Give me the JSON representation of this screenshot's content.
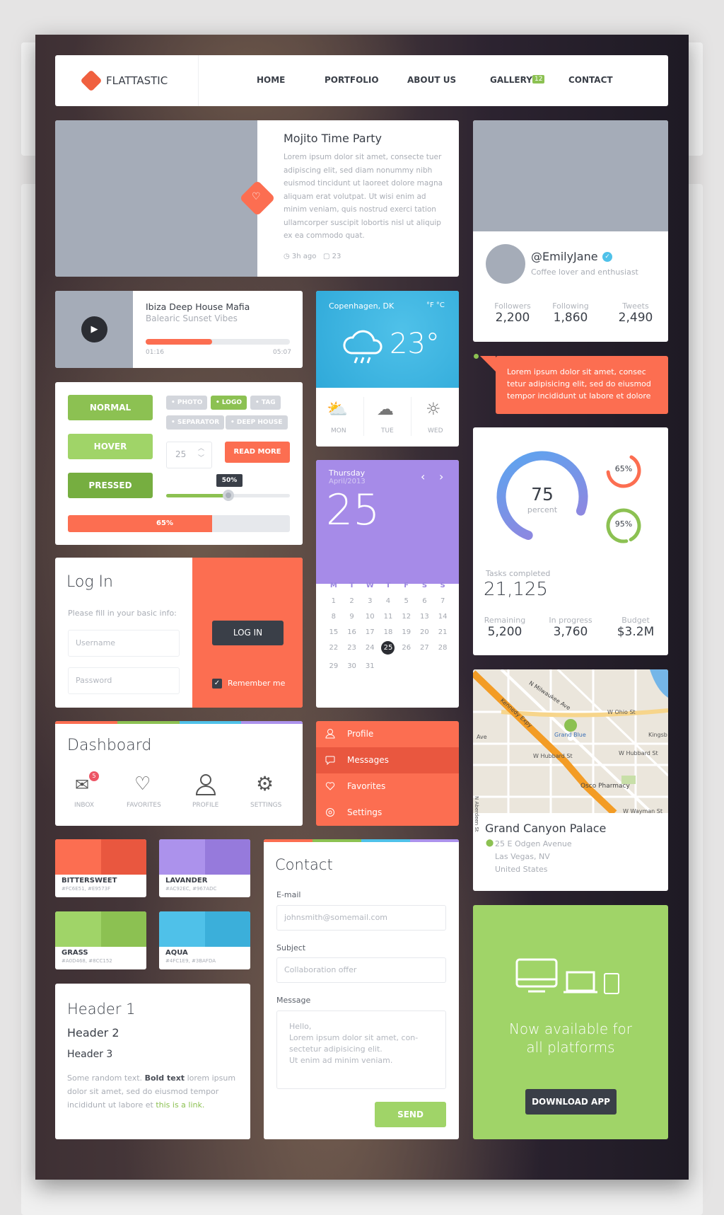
{
  "nav": {
    "logo": "FLATTASTIC",
    "items": [
      "HOME",
      "PORTFOLIO",
      "ABOUT US",
      "GALLERY",
      "CONTACT"
    ],
    "gallery_badge": "12"
  },
  "post": {
    "title": "Mojito Time Party",
    "body": "Lorem ipsum dolor sit amet, consecte tuer adipiscing elit, sed diam nonummy nibh euismod tincidunt ut laoreet dolore magna aliquam erat volutpat. Ut wisi enim ad minim veniam, quis nostrud exerci tation ullamcorper suscipit lobortis nisl ut aliquip ex ea commodo quat.",
    "time": "3h ago",
    "comments": "23",
    "icons": [
      "heart-icon",
      "clock-icon",
      "comment-icon"
    ]
  },
  "profile": {
    "handle": "@EmilyJane",
    "bio": "Coffee lover and enthusiast",
    "stats": [
      {
        "label": "Followers",
        "value": "2,200"
      },
      {
        "label": "Following",
        "value": "1,860"
      },
      {
        "label": "Tweets",
        "value": "2,490"
      }
    ]
  },
  "player": {
    "title": "Ibiza Deep House Mafia",
    "subtitle": "Balearic Sunset Vibes",
    "elapsed": "01:16",
    "total": "05:07",
    "progress": 0.46
  },
  "weather": {
    "city": "Copenhagen, DK",
    "units": "°F °C",
    "temp": "23°",
    "days": [
      {
        "name": "MON",
        "icon": "partly-cloudy-icon"
      },
      {
        "name": "TUE",
        "icon": "cloud-icon"
      },
      {
        "name": "WED",
        "icon": "sun-icon"
      }
    ]
  },
  "tooltip": {
    "text": "Lorem ipsum dolor sit amet, consec tetur adipisicing elit, sed do eiusmod tempor incididunt ut labore et dolore"
  },
  "controls": {
    "buttons": [
      "NORMAL",
      "HOVER",
      "PRESSED"
    ],
    "tags": [
      "PHOTO",
      "LOGO",
      "TAG",
      "SEPARATOR",
      "DEEP HOUSE"
    ],
    "active_tag": "LOGO",
    "stepper_value": "25",
    "read_more": "READ MORE",
    "slider_label": "50%",
    "slider_value": 0.5,
    "progress_label": "65%",
    "progress_value": 0.65
  },
  "stats": {
    "main_value": "75",
    "main_unit": "percent",
    "main_pct": 75,
    "small": [
      {
        "label": "65%",
        "pct": 65,
        "color": "#FC6E51"
      },
      {
        "label": "95%",
        "pct": 95,
        "color": "#8CC152"
      }
    ],
    "tasks_label": "Tasks completed",
    "tasks_value": "21,125",
    "items": [
      {
        "label": "Remaining",
        "value": "5,200"
      },
      {
        "label": "In progress",
        "value": "3,760"
      },
      {
        "label": "Budget",
        "value": "$3.2M"
      }
    ]
  },
  "calendar": {
    "weekday": "Thursday",
    "month": "April/2013",
    "day": "25",
    "headers": [
      "M",
      "T",
      "W",
      "T",
      "F",
      "S",
      "S"
    ],
    "days": [
      "1",
      "2",
      "3",
      "4",
      "5",
      "6",
      "7",
      "8",
      "9",
      "10",
      "11",
      "12",
      "13",
      "14",
      "15",
      "16",
      "17",
      "18",
      "19",
      "20",
      "21",
      "22",
      "23",
      "24",
      "25",
      "26",
      "27",
      "28",
      "29",
      "30",
      "31"
    ],
    "selected": "25"
  },
  "login": {
    "title": "Log In",
    "hint": "Please fill in your basic info:",
    "username_ph": "Username",
    "password_ph": "Password",
    "button": "LOG IN",
    "remember": "Remember me"
  },
  "dashboard": {
    "title": "Dashboard",
    "items": [
      {
        "label": "INBOX",
        "icon": "mail-icon",
        "badge": "5"
      },
      {
        "label": "FAVORITES",
        "icon": "heart-icon"
      },
      {
        "label": "PROFILE",
        "icon": "user-icon"
      },
      {
        "label": "SETTINGS",
        "icon": "gear-icon"
      }
    ]
  },
  "menu": {
    "items": [
      "Profile",
      "Messages",
      "Favorites",
      "Settings"
    ],
    "active": "Messages"
  },
  "map": {
    "labels": [
      "N Milwaukee Ave",
      "Kennedy Expy",
      "W Ohio St",
      "Grand Blue",
      "Kingsb",
      "Ave",
      "W Hubbard St",
      "W Hubbard St",
      "Osco Pharmacy",
      "N Aberdeen St",
      "W Wayman St"
    ],
    "place": "Grand Canyon Palace",
    "address": [
      "25 E Odgen Avenue",
      "Las Vegas, NV",
      "United States"
    ]
  },
  "swatches": [
    {
      "name": "BITTERSWEET",
      "codes": "#FC6E51, #E9573F",
      "c1": "#FC6E51",
      "c2": "#E9573F"
    },
    {
      "name": "LAVANDER",
      "codes": "#AC92EC, #967ADC",
      "c1": "#AC92EC",
      "c2": "#967ADC"
    },
    {
      "name": "GRASS",
      "codes": "#A0D468, #8CC152",
      "c1": "#A0D468",
      "c2": "#8CC152"
    },
    {
      "name": "AQUA",
      "codes": "#4FC1E9, #3BAFDA",
      "c1": "#4FC1E9",
      "c2": "#3BAFDA"
    }
  ],
  "typography": {
    "h1": "Header 1",
    "h2": "Header 2",
    "h3": "Header 3",
    "text": "Some random text.",
    "bold": "Bold text",
    "text2": "lorem ipsum dolor sit amet, sed do eiusmod tempor incididunt ut labore et",
    "link": "this is a link."
  },
  "contact": {
    "title": "Contact",
    "email_label": "E-mail",
    "email_ph": "johnsmith@somemail.com",
    "subject_label": "Subject",
    "subject_ph": "Collaboration offer",
    "message_label": "Message",
    "message_ph": "Hello,\nLorem ipsum dolor sit amet, con-\nsectetur adipisicing elit.\nUt enim ad minim veniam.",
    "send": "SEND"
  },
  "promo": {
    "text": "Now available for all platforms",
    "button": "DOWNLOAD APP"
  }
}
